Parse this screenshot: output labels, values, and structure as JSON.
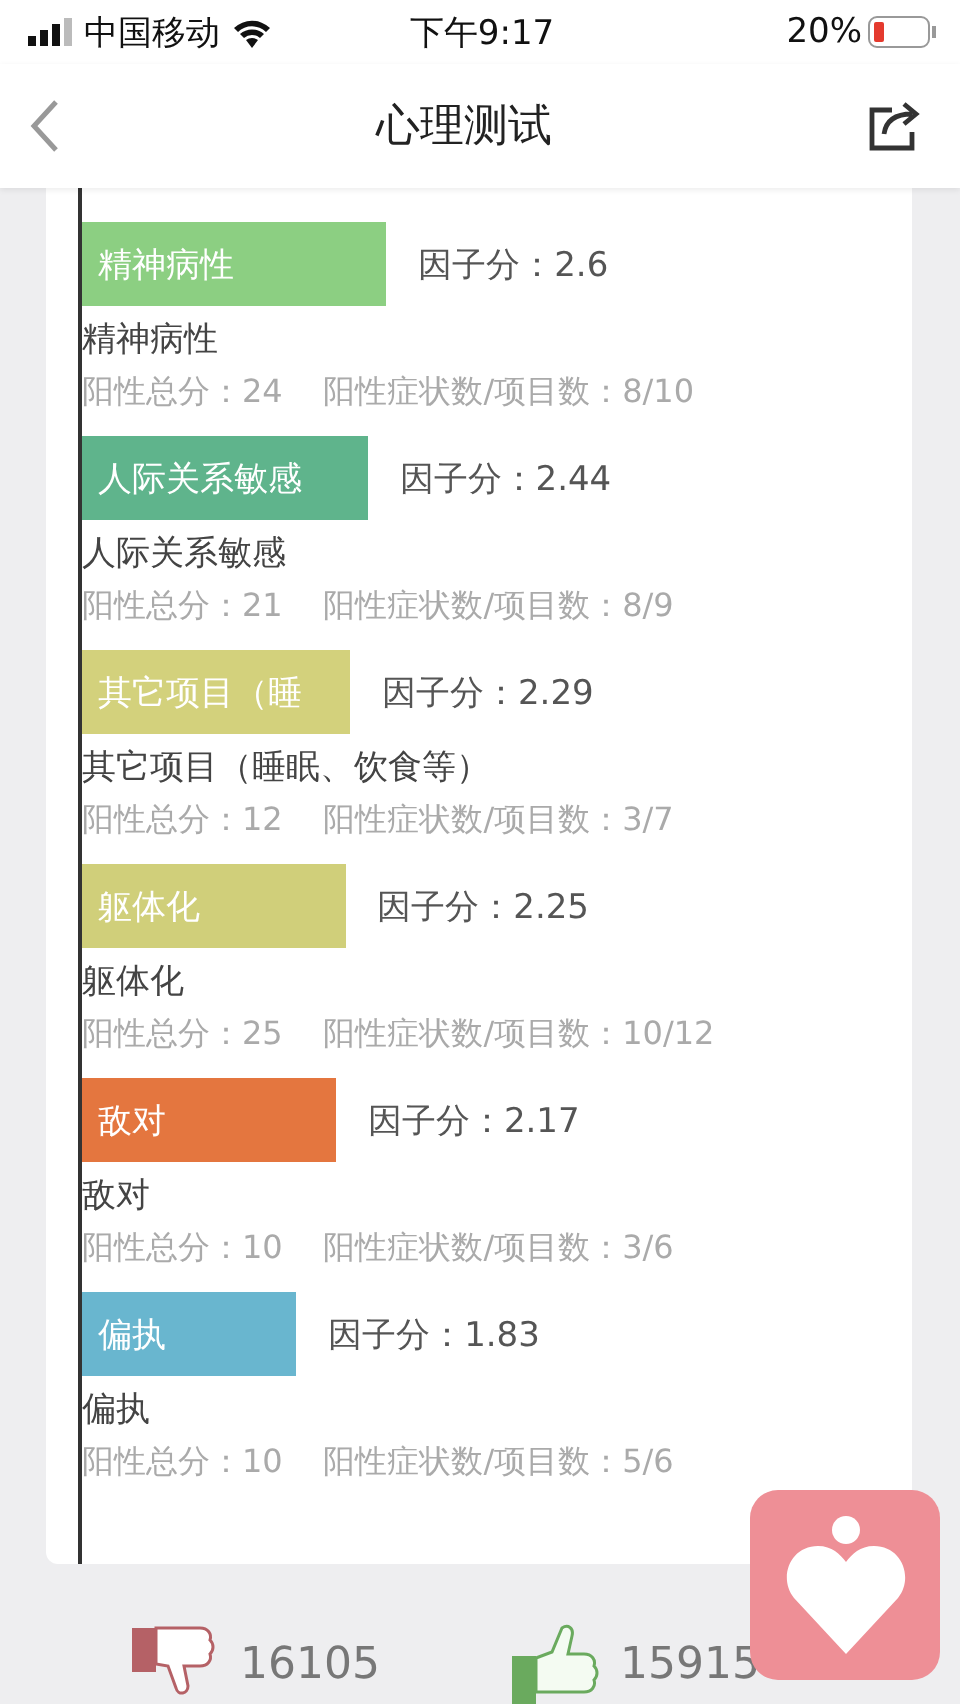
{
  "status_bar": {
    "carrier": "中国移动",
    "time": "下午9:17",
    "battery": "20%"
  },
  "nav": {
    "title": "心理测试"
  },
  "factors": [
    {
      "bar_label": "精神病性",
      "score_label": "因子分：2.6",
      "name": "精神病性",
      "stats": "阳性总分：24    阳性症状数/项目数：8/10",
      "color": "#8ccf82"
    },
    {
      "bar_label": "人际关系敏感",
      "score_label": "因子分：2.44",
      "name": "人际关系敏感",
      "stats": "阳性总分：21    阳性症状数/项目数：8/9",
      "color": "#5fb48c"
    },
    {
      "bar_label": "其它项目（睡",
      "score_label": "因子分：2.29",
      "name": "其它项目（睡眠、饮食等）",
      "stats": "阳性总分：12    阳性症状数/项目数：3/7",
      "color": "#d3d17c"
    },
    {
      "bar_label": "躯体化",
      "score_label": "因子分：2.25",
      "name": "躯体化",
      "stats": "阳性总分：25    阳性症状数/项目数：10/12",
      "color": "#d0cf7a"
    },
    {
      "bar_label": "敌对",
      "score_label": "因子分：2.17",
      "name": "敌对",
      "stats": "阳性总分：10    阳性症状数/项目数：3/6",
      "color": "#e4763f"
    },
    {
      "bar_label": "偏执",
      "score_label": "因子分：1.83",
      "name": "偏执",
      "stats": "阳性总分：10    阳性症状数/项目数：5/6",
      "color": "#69b6cf"
    }
  ],
  "votes": [
    {
      "kind": "down",
      "count": "16105"
    },
    {
      "kind": "up",
      "count": "15915"
    }
  ]
}
